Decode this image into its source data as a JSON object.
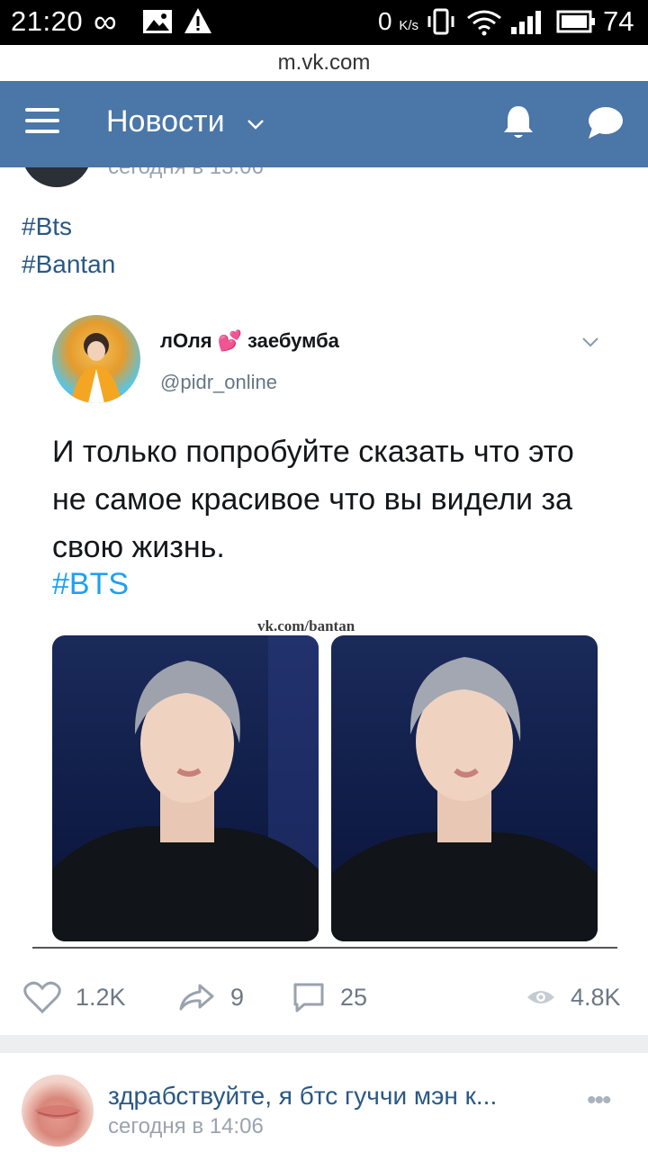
{
  "status_bar": {
    "time": "21:20",
    "net_speed": "0",
    "net_unit": "K/s",
    "battery": "74"
  },
  "browser": {
    "url": "m.vk.com"
  },
  "header": {
    "title": "Новости"
  },
  "post": {
    "hashtags": [
      "#Bts",
      "#Bantan"
    ],
    "tweet": {
      "name_part1": "лОля",
      "name_emoji": "💕",
      "name_part2": "заебумба",
      "handle": "@pidr_online",
      "text": "И только попробуйте сказать что это не самое красивое что вы видели за свою жизнь.",
      "hashtag": "#BTS",
      "watermark": "vk.com/bantan"
    },
    "stats": {
      "likes": "1.2K",
      "shares": "9",
      "comments": "25",
      "views": "4.8K"
    }
  },
  "next_post": {
    "author": "здрабствуйте, я бтс гуччи мэн к...",
    "time": "сегодня в 14:06"
  },
  "colors": {
    "header_bg": "#4a76a8",
    "link": "#2a5885",
    "twitter_blue": "#1da1f2",
    "muted": "#6d7885"
  }
}
